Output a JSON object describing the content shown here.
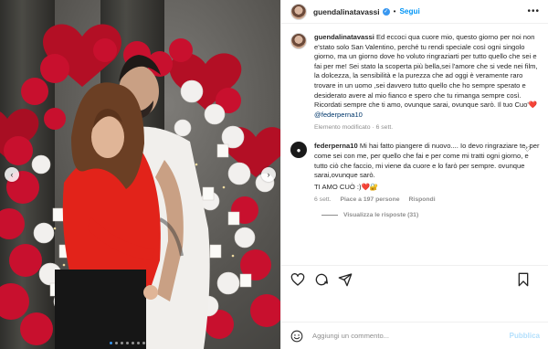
{
  "post": {
    "username": "guendalinatavassi",
    "follow_label": "Segui",
    "separator": "•"
  },
  "caption": {
    "username": "guendalinatavassi",
    "text": "Ed eccoci qua cuore mio, questo giorno per noi non e'stato solo San Valentino, perché tu rendi speciale così ogni singolo giorno, ma un giorno dove ho voluto ringraziarti per tutto quello che sei e fai per me! Sei stato la scoperta più bella,sei l'amore che si vede nei film, la dolcezza, la sensibilità e la purezza che ad oggi è veramente raro trovare in un uomo ,sei davvero tutto quello che ho sempre sperato e desiderato avere al mio fianco e spero che tu rimanga sempre così. Ricordati sempre che ti amo, ovunque sarai, ovunque sarò. Il tuo Cuo'",
    "heart": "❤️",
    "mention": "@federperna10",
    "meta": "Elemento modificato · 6 sett."
  },
  "reply": {
    "username": "federperna10",
    "text": "Mi hai fatto piangere di nuovo.... Io devo ringraziare te, per come sei con me, per quello che fai e per come mi tratti ogni giorno, e tutto ciò che faccio, mi viene da cuore e lo farò per sempre. ovunque sarai,ovunque sarò.",
    "signoff": "TI AMO CUÒ :)❤️🔐",
    "time": "6 sett.",
    "likes": "Piace a 197 persone",
    "reply_label": "Rispondi",
    "view_replies": "Visualizza le risposte (31)"
  },
  "composer": {
    "placeholder": "Aggiungi un commento...",
    "publish_label": "Pubblica"
  },
  "icons": [
    "heart-icon",
    "comment-icon",
    "share-icon",
    "bookmark-icon",
    "emoji-icon",
    "more-icon",
    "verified-icon"
  ],
  "colors": {
    "link": "#0095f6",
    "mention": "#00376b",
    "muted": "#8e8e8e",
    "balloon": "#c8102e",
    "sweater": "#e2231a"
  },
  "carousel": {
    "slides": 7,
    "current": 1
  }
}
